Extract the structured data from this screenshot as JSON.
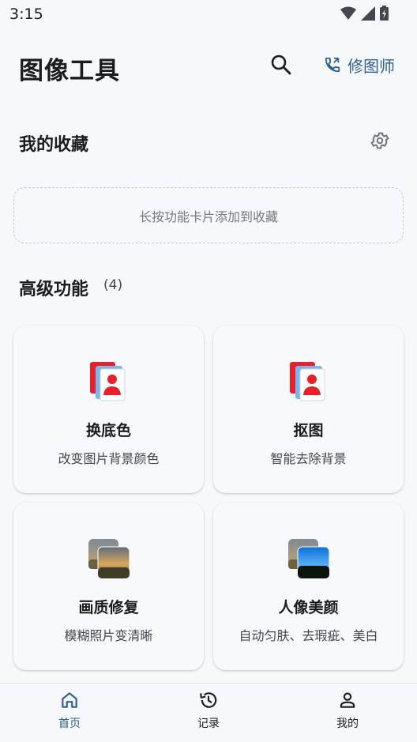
{
  "status_bar": {
    "time": "3:15"
  },
  "app_bar": {
    "title": "图像工具",
    "retouch_label": "修图师"
  },
  "favorites": {
    "title": "我的收藏",
    "empty_hint": "长按功能卡片添加到收藏"
  },
  "advanced": {
    "title": "高级功能",
    "count": "(4)",
    "cards": [
      {
        "name": "换底色",
        "desc": "改变图片背景颜色",
        "icon": "id-photo-icon"
      },
      {
        "name": "抠图",
        "desc": "智能去除背景",
        "icon": "id-photo-icon"
      },
      {
        "name": "画质修复",
        "desc": "模糊照片变清晰",
        "icon": "landscape-photo-icon"
      },
      {
        "name": "人像美颜",
        "desc": "自动匀肤、去瑕疵、美白",
        "icon": "landscape-photo-icon"
      }
    ]
  },
  "bottom_nav": {
    "items": [
      {
        "label": "首页",
        "icon": "home-icon",
        "active": true
      },
      {
        "label": "记录",
        "icon": "history-icon",
        "active": false
      },
      {
        "label": "我的",
        "icon": "person-icon",
        "active": false
      }
    ]
  },
  "colors": {
    "accent": "#2d5f8f",
    "background": "#f6f8fc",
    "red": "#e8202a"
  }
}
